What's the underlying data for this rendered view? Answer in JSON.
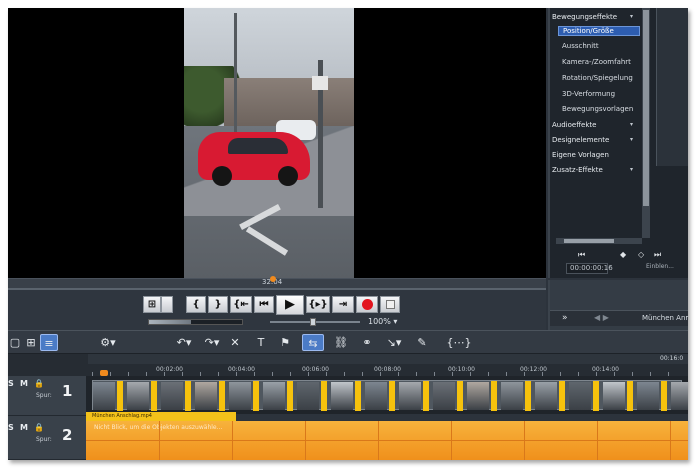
{
  "preview": {
    "scrub_time": "32:04"
  },
  "transport": {
    "buttons": [
      "⊞",
      "{",
      "}",
      "{⇤",
      "⏮",
      "▶",
      "{▸}",
      "⇥",
      "",
      ""
    ],
    "progress_fraction": 0.45,
    "zoom_label": "100% ▾"
  },
  "effects_panel": {
    "categories": [
      {
        "label": "Bewegungseffekte",
        "expanded": true
      },
      {
        "label": "Audioeffekte",
        "expanded": false
      },
      {
        "label": "Designelemente",
        "expanded": false
      },
      {
        "label": "Eigene Vorlagen",
        "expanded": false
      },
      {
        "label": "Zusatz-Effekte",
        "expanded": false
      }
    ],
    "sub_items": [
      "Position/Größe",
      "Ausschnitt",
      "Kamera-/Zoomfahrt",
      "Rotation/Spiegelung",
      "3D-Verformung",
      "Bewegungsvorlagen"
    ],
    "selected_sub_item": "Position/Größe",
    "time_field": "00:00:00:16",
    "fade_label": "Einblen...",
    "bottom_title": "München Anm"
  },
  "toolbar": {
    "tools": [
      "⚙▾",
      "↶▾",
      "↷▾",
      "✕",
      "T",
      "⚑",
      "⇆",
      "⛓",
      "⚭",
      "↘▾",
      "✎",
      "{⋯}▾"
    ]
  },
  "timeline": {
    "ruler_labels": [
      "00:02:00",
      "00:04:00",
      "00:06:00",
      "00:08:00",
      "00:10:00",
      "00:12:00",
      "00:14:00"
    ],
    "ruler_end": "00:16:0",
    "tracks": [
      {
        "s": "S",
        "m": "M",
        "lock": "🔒",
        "label": "Spur:",
        "number": "1"
      },
      {
        "s": "S",
        "m": "M",
        "lock": "🔒",
        "label": "Spur:",
        "number": "2"
      }
    ],
    "track1_clip_label": "München Anschlag.mp4",
    "track2_text": "Nicht Blick, um die Objekten auszuwähle..."
  },
  "colors": {
    "accent_orange": "#f08a1e",
    "clip_yellow": "#f6c20d",
    "selection_blue": "#2d5db0",
    "record_red": "#e2141e"
  }
}
